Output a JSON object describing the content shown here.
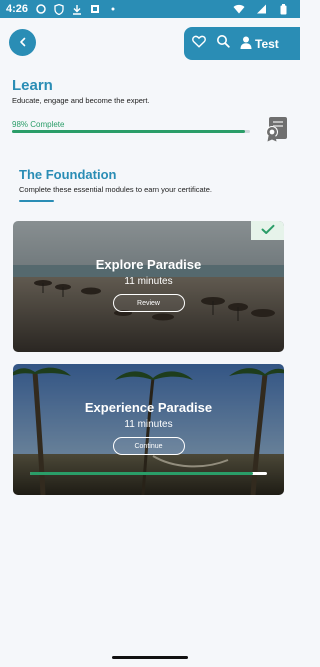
{
  "status": {
    "time": "4:26"
  },
  "header": {
    "user_label": "Test"
  },
  "learn": {
    "title": "Learn",
    "subtitle": "Educate, engage and become the expert.",
    "progress_label": "98% Complete",
    "progress_value": 0.98
  },
  "foundation": {
    "title": "The Foundation",
    "subtitle": "Complete these essential modules to earn your certificate."
  },
  "modules": [
    {
      "title": "Explore Paradise",
      "duration": "11 minutes",
      "button": "Review",
      "completed": true
    },
    {
      "title": "Experience Paradise",
      "duration": "11 minutes",
      "button": "Continue",
      "progress": 0.94
    }
  ],
  "colors": {
    "primary": "#2a8db5",
    "success": "#2a9d68"
  }
}
